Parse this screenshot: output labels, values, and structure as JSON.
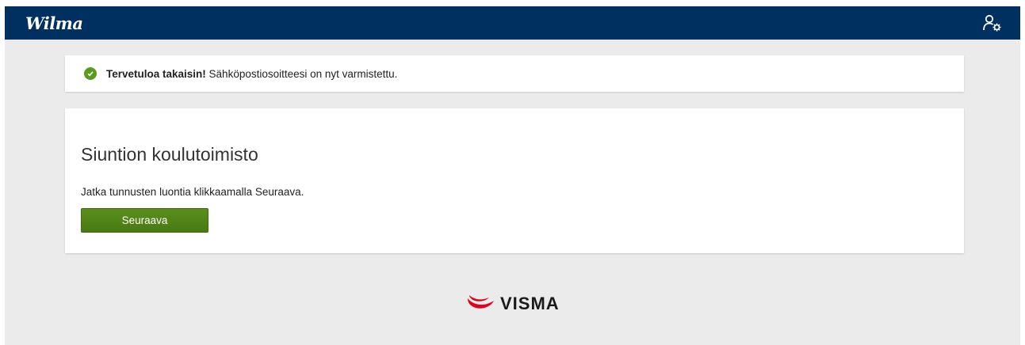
{
  "header": {
    "logo_text": "Wilma",
    "user_menu_icon": "user-settings-icon"
  },
  "notice": {
    "icon": "check-circle-icon",
    "bold_text": "Tervetuloa takaisin!",
    "text": " Sähköpostiosoitteesi on nyt varmistettu."
  },
  "card": {
    "title": "Siuntion koulutoimisto",
    "instruction": "Jatka tunnusten luontia klikkaamalla Seuraava.",
    "next_button": "Seuraava"
  },
  "footer": {
    "brand": "VISMA",
    "brand_color": "#e2001a"
  },
  "colors": {
    "topbar": "#00305f",
    "button": "#4f8318",
    "success": "#5a9a1e",
    "background": "#ebebeb"
  }
}
